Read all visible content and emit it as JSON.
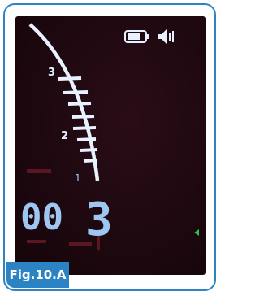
{
  "device": {
    "display": {
      "battery_icon": "battery-icon",
      "speaker_icon": "speaker-icon",
      "scale_labels": [
        "3",
        "2",
        "1"
      ],
      "counter_value": "00",
      "apex_indicator": "3",
      "apex_arrow_icon": "triangle-left-icon"
    }
  },
  "caption": {
    "label": "Fig.10.A"
  },
  "colors": {
    "frame_border": "#2d84c0",
    "screen_bg": "#1e0810",
    "segment_color": "#e8f2ff",
    "digit_color": "#9fc6f0",
    "caption_bg": "#2c83c4",
    "caption_text": "#ffffff",
    "arrow_color": "#29c24a"
  }
}
